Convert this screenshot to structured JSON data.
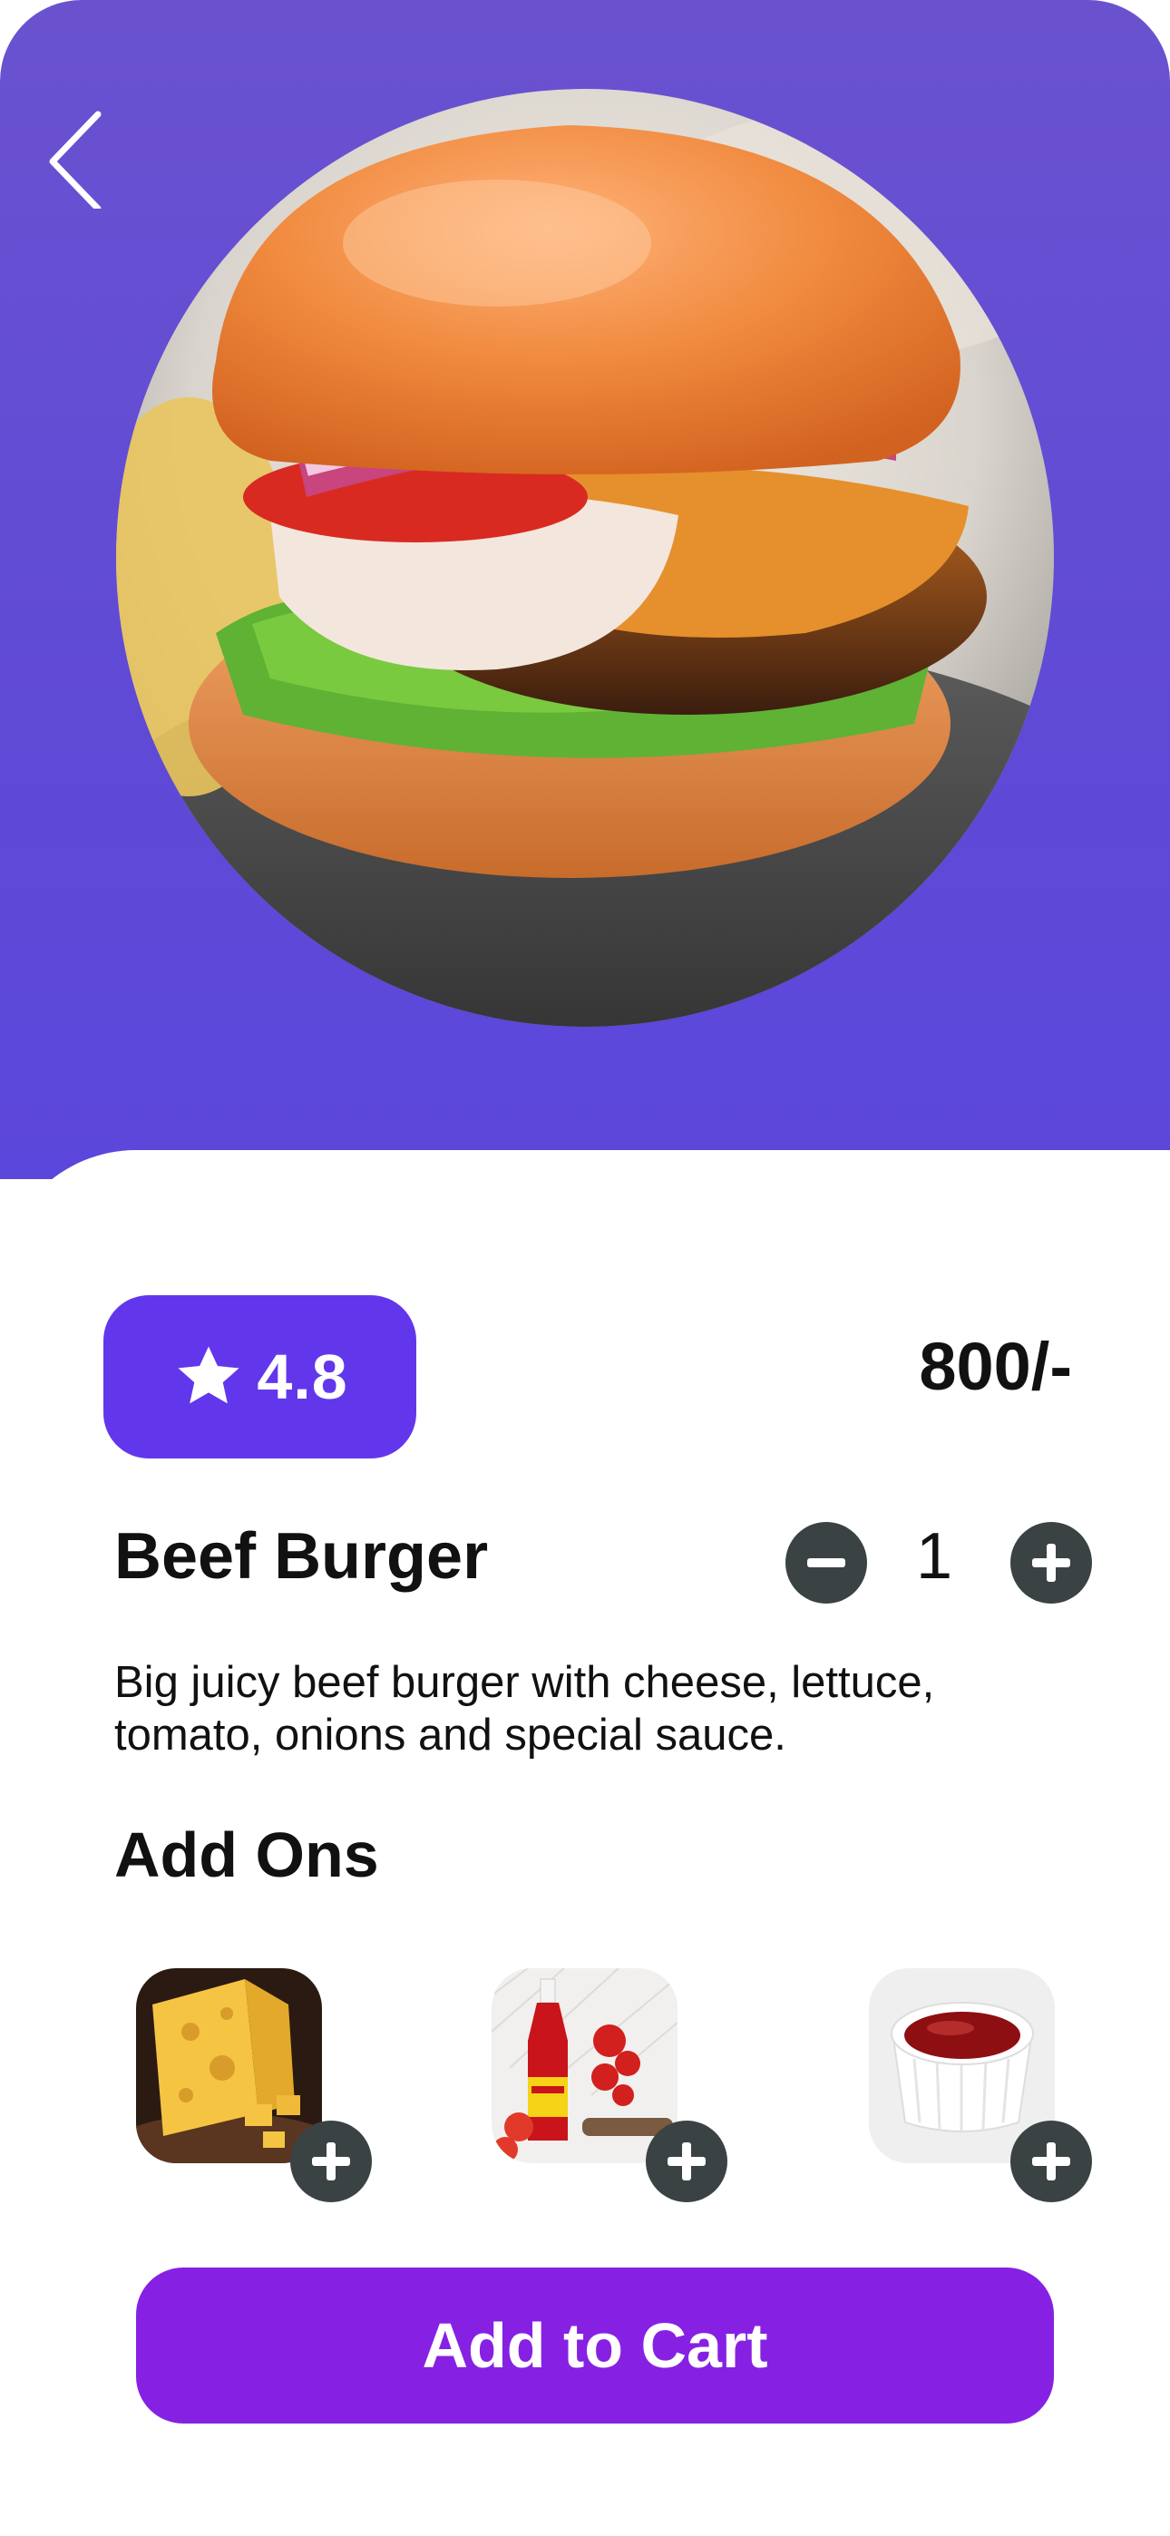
{
  "header": {
    "back_icon": "chevron-left-icon"
  },
  "hero": {
    "image_subject": "burger-photo"
  },
  "product": {
    "rating": "4.8",
    "rating_icon": "star-icon",
    "price": "800/-",
    "name": "Beef Burger",
    "quantity": "1",
    "description": "Big juicy beef burger with cheese, lettuce, tomato, onions and special sauce."
  },
  "addons": {
    "title": "Add Ons",
    "items": [
      {
        "image": "cheese-photo",
        "add_icon": "plus-icon"
      },
      {
        "image": "ketchup-bottle-photo",
        "add_icon": "plus-icon"
      },
      {
        "image": "ketchup-bowl-photo",
        "add_icon": "plus-icon"
      }
    ]
  },
  "actions": {
    "add_to_cart_label": "Add to Cart"
  },
  "colors": {
    "hero_background": "#5f4ad6",
    "rating_badge": "#6237ec",
    "cart_button": "#8621e3",
    "control_button": "#3a4244",
    "text": "#111111"
  }
}
